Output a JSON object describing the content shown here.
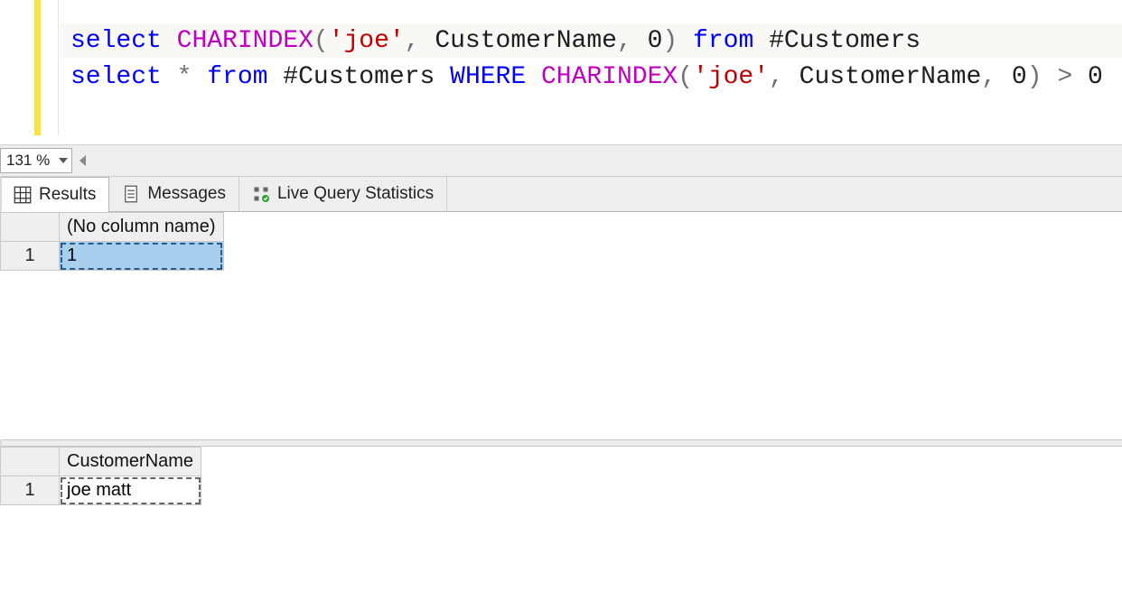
{
  "editor": {
    "zoom_level": "131 %",
    "line1": {
      "kw_select": "select",
      "fn_charindex": "CHARINDEX",
      "lparen": "(",
      "str_joe": "'joe'",
      "comma1": ",",
      "id_customer_name": "CustomerName",
      "comma2": ",",
      "num_zero": "0",
      "rparen": ")",
      "kw_from": "from",
      "tbl_customers": "#Customers"
    },
    "line2": {
      "kw_select": "select",
      "star": "*",
      "kw_from": "from",
      "tbl_customers": "#Customers",
      "kw_where": "WHERE",
      "fn_charindex": "CHARINDEX",
      "lparen": "(",
      "str_joe": "'joe'",
      "comma1": ",",
      "id_customer_name": "CustomerName",
      "comma2": ",",
      "num_zero": "0",
      "rparen": ")",
      "gt": ">",
      "num_zero2": "0"
    }
  },
  "tabs": {
    "results": "Results",
    "messages": "Messages",
    "live_stats": "Live Query Statistics"
  },
  "grid1": {
    "header_no_col": "(No column name)",
    "row1_num": "1",
    "row1_val": "1"
  },
  "grid2": {
    "header_customer_name": "CustomerName",
    "row1_num": "1",
    "row1_val": "joe matt"
  },
  "icons": {
    "results": "grid-icon",
    "messages": "doc-icon",
    "live_stats": "stats-icon"
  }
}
